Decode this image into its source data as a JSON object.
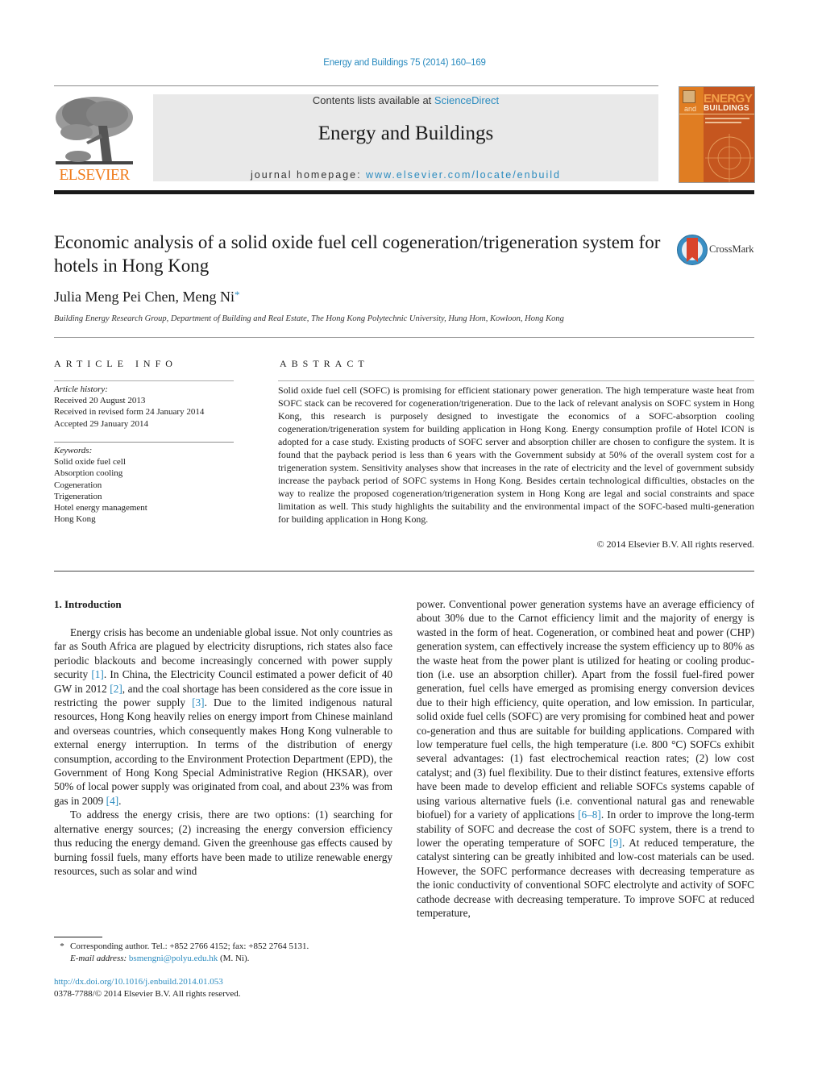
{
  "header": {
    "citation": "Energy and Buildings 75 (2014) 160–169",
    "publisher_logo_text": "ELSEVIER",
    "contents_prefix": "Contents lists available at ",
    "contents_link": "ScienceDirect",
    "journal_name": "Energy and Buildings",
    "homepage_prefix": "journal homepage: ",
    "homepage_link": "www.elsevier.com/locate/enbuild",
    "cover": {
      "line1": "ENERGY",
      "line2_prefix": "and",
      "line2": "BUILDINGS"
    },
    "colors": {
      "link": "#2a8bbf",
      "elsevier_orange": "#f07c1b",
      "banner_bg": "#e9e9e9",
      "cover_bg": "#c5561f"
    }
  },
  "article": {
    "title": "Economic analysis of a solid oxide fuel cell cogeneration/trigeneration system for hotels in Hong Kong",
    "crossmark_label": "CrossMark",
    "authors": "Julia Meng Pei Chen, Meng Ni",
    "corresponding_marker": "*",
    "affiliation": "Building Energy Research Group, Department of Building and Real Estate, The Hong Kong Polytechnic University, Hung Hom, Kowloon, Hong Kong"
  },
  "article_info": {
    "heading": "ARTICLE INFO",
    "history_label": "Article history:",
    "history": [
      "Received 20 August 2013",
      "Received in revised form 24 January 2014",
      "Accepted 29 January 2014"
    ],
    "keywords_label": "Keywords:",
    "keywords": [
      "Solid oxide fuel cell",
      "Absorption cooling",
      "Cogeneration",
      "Trigeneration",
      "Hotel energy management",
      "Hong Kong"
    ]
  },
  "abstract": {
    "heading": "ABSTRACT",
    "text": "Solid oxide fuel cell (SOFC) is promising for efficient stationary power generation. The high temperature waste heat from SOFC stack can be recovered for cogeneration/trigeneration. Due to the lack of relevant analysis on SOFC system in Hong Kong, this research is purposely designed to investigate the economics of a SOFC-absorption cooling cogeneration/trigeneration system for building application in Hong Kong. Energy consumption profile of Hotel ICON is adopted for a case study. Existing products of SOFC server and absorption chiller are chosen to configure the system. It is found that the payback period is less than 6 years with the Government subsidy at 50% of the overall system cost for a trigeneration system. Sensitivity analyses show that increases in the rate of electricity and the level of government subsidy increase the payback period of SOFC systems in Hong Kong. Besides certain technological difficulties, obstacles on the way to realize the proposed cogeneration/trigeneration system in Hong Kong are legal and social constraints and space limitation as well. This study highlights the suitability and the environmental impact of the SOFC-based multi-generation for building application in Hong Kong.",
    "copyright": "© 2014 Elsevier B.V. All rights reserved."
  },
  "body": {
    "section_heading": "1.  Introduction",
    "left_paragraphs": [
      [
        {
          "t": "Energy crisis has become an undeniable global issue. Not only countries as far as South Africa are plagued by electricity dis­ruptions, rich states also face periodic blackouts and become increasingly concerned with power supply security "
        },
        {
          "ref": "[1]"
        },
        {
          "t": ". In China, the Electricity Council estimated a power deficit of 40 GW in 2012 "
        },
        {
          "ref": "[2]"
        },
        {
          "t": ", and the coal shortage has been considered as the core issue in restricting the power supply "
        },
        {
          "ref": "[3]"
        },
        {
          "t": ". Due to the limited indigenous natural resources, Hong Kong heavily relies on energy import from Chinese mainland and overseas countries, which consequently makes Hong Kong vulnerable to external energy interruption. In terms of the distribution of energy consumption, according to the Environment Protection Department (EPD), the Government of Hong Kong Special Administrative Region (HKSAR), over 50% of local power supply was originated from coal, and about 23% was from gas in 2009 "
        },
        {
          "ref": "[4]"
        },
        {
          "t": "."
        }
      ],
      [
        {
          "t": "To address the energy crisis, there are two options: (1) searching for alternative energy sources; (2) increasing the energy conversion efficiency thus reducing the energy demand. Given the greenhouse gas effects caused by burning fossil fuels, many efforts have been made to utilize renewable energy resources, such as solar and wind"
        }
      ]
    ],
    "right_paragraphs": [
      [
        {
          "t": "power. Conventional power generation systems have an average efficiency of about 30% due to the Carnot efficiency limit and the majority of energy is wasted in the form of heat. Cogeneration, or combined heat and power (CHP) generation system, can effec­tively increase the system efficiency up to 80% as the waste heat from the power plant is utilized for heating or cooling produc­tion (i.e. use an absorption chiller). Apart from the fossil fuel-fired power generation, fuel cells have emerged as promising energy conversion devices due to their high efficiency, quite operation, and low emission. In particular, solid oxide fuel cells (SOFC) are very promising for combined heat and power co-generation and thus are suitable for building applications. Compared with low temperature fuel cells, the high temperature (i.e. 800 °C) SOFCs exhibit several advantages: (1) fast electrochemical reaction rates; (2) low cost catalyst; and (3) fuel flexibility. Due to their distinct features, extensive efforts have been made to develop efficient and reliable SOFCs systems capable of using various alternative fuels (i.e. conventional natural gas and renewable biofuel) for a variety of applications "
        },
        {
          "ref": "[6–8]"
        },
        {
          "t": ". In order to improve the long-term stability of SOFC and decrease the cost of SOFC system, there is a trend to lower the operating temperature of SOFC "
        },
        {
          "ref": "[9]"
        },
        {
          "t": ". At reduced temper­ature, the catalyst sintering can be greatly inhibited and low-cost materials can be used. However, the SOFC performance decreases with decreasing temperature as the ionic conductivity of conven­tional SOFC electrolyte and activity of SOFC cathode decrease with decreasing temperature. To improve SOFC at reduced temperature,"
        }
      ]
    ]
  },
  "footnote": {
    "marker": "*",
    "corresponding": "Corresponding author. Tel.: +852 2766 4152; fax: +852 2764 5131.",
    "email_label": "E-mail address:",
    "email": "bsmengni@polyu.edu.hk",
    "email_suffix": " (M. Ni).",
    "doi": "http://dx.doi.org/10.1016/j.enbuild.2014.01.053",
    "issn_copyright": "0378-7788/© 2014 Elsevier B.V. All rights reserved."
  }
}
